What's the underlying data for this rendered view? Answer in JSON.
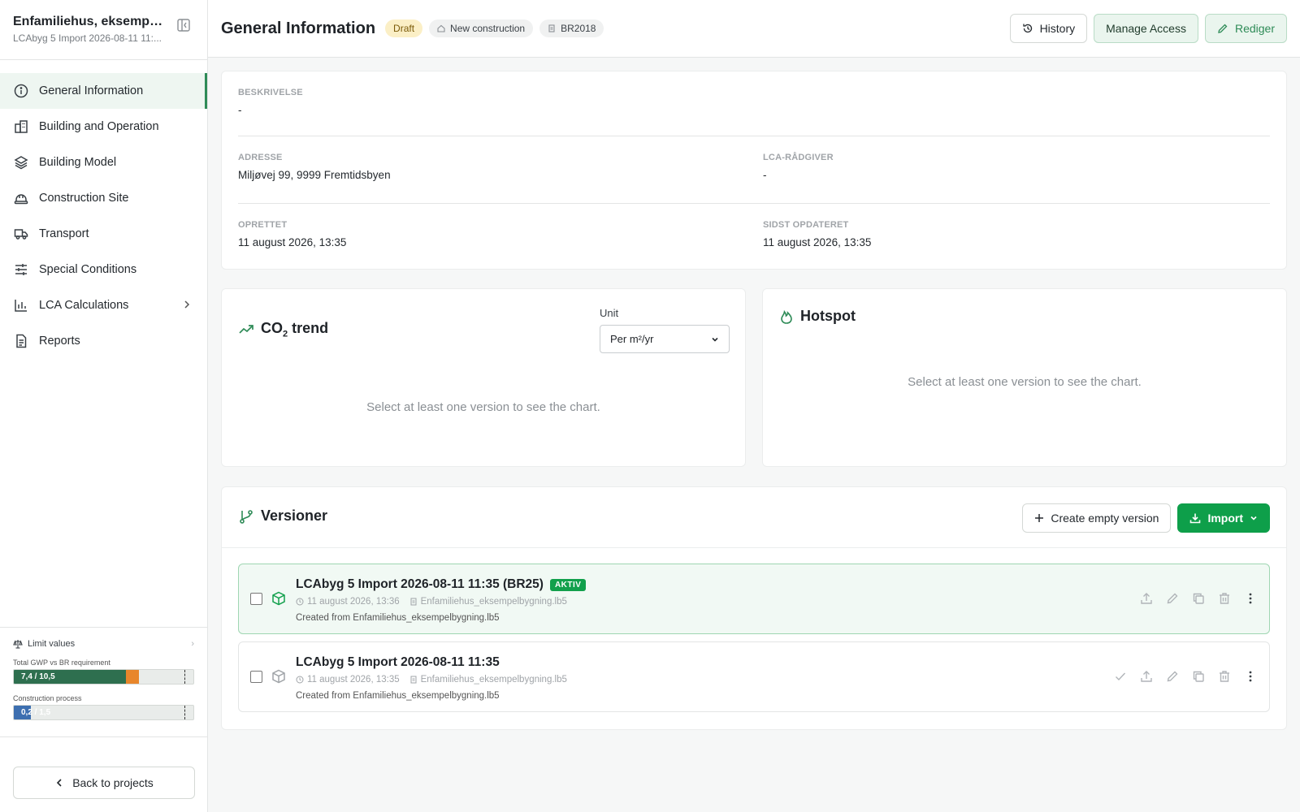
{
  "sidebar": {
    "project_title": "Enfamiliehus, eksempel...",
    "project_subtitle": "LCAbyg 5 Import 2026-08-11 11:...",
    "items": [
      {
        "label": "General Information"
      },
      {
        "label": "Building and Operation"
      },
      {
        "label": "Building Model"
      },
      {
        "label": "Construction Site"
      },
      {
        "label": "Transport"
      },
      {
        "label": "Special Conditions"
      },
      {
        "label": "LCA Calculations"
      },
      {
        "label": "Reports"
      }
    ],
    "limit": {
      "title": "Limit values",
      "bar1_label": "Total GWP vs BR requirement",
      "bar1_text": "7,4 / 10,5",
      "bar2_label": "Construction process",
      "bar2_text": "0,2 / 1,5"
    },
    "back_label": "Back to projects"
  },
  "header": {
    "title": "General Information",
    "badges": {
      "draft": "Draft",
      "type": "New construction",
      "regulation": "BR2018"
    },
    "history": "History",
    "manage_access": "Manage Access",
    "edit": "Rediger"
  },
  "info": {
    "description_label": "BESKRIVELSE",
    "description_value": "-",
    "address_label": "ADRESSE",
    "address_value": "Miljøvej 99, 9999 Fremtidsbyen",
    "advisor_label": "LCA-RÅDGIVER",
    "advisor_value": "-",
    "created_label": "OPRETTET",
    "created_value": "11 august 2026, 13:35",
    "updated_label": "SIDST OPDATERET",
    "updated_value": "11 august 2026, 13:35"
  },
  "co2": {
    "title_main": "CO",
    "title_sub": "2",
    "title_rest": " trend",
    "unit_label": "Unit",
    "unit_value": "Per m²/yr",
    "empty": "Select at least one version to see the chart."
  },
  "hotspot": {
    "title": "Hotspot",
    "empty": "Select at least one version to see the chart."
  },
  "versions": {
    "title": "Versioner",
    "create_empty": "Create empty version",
    "import": "Import",
    "items": [
      {
        "name": "LCAbyg 5 Import 2026-08-11 11:35 (BR25)",
        "badge": "AKTIV",
        "date": "11 august 2026, 13:36",
        "file": "Enfamiliehus_eksempelbygning.lb5",
        "created_from": "Created from Enfamiliehus_eksempelbygning.lb5"
      },
      {
        "name": "LCAbyg 5 Import 2026-08-11 11:35",
        "date": "11 august 2026, 13:35",
        "file": "Enfamiliehus_eksempelbygning.lb5",
        "created_from": "Created from Enfamiliehus_eksempelbygning.lb5"
      }
    ]
  },
  "colors": {
    "accent_green": "#0e9f4a",
    "gwp_bar": "#2e6f4f",
    "gwp_over": "#e8862b",
    "construction_bar": "#3d6fb0"
  },
  "levels": {
    "gwp_fraction": 0.705,
    "construction_fraction": 0.133
  }
}
